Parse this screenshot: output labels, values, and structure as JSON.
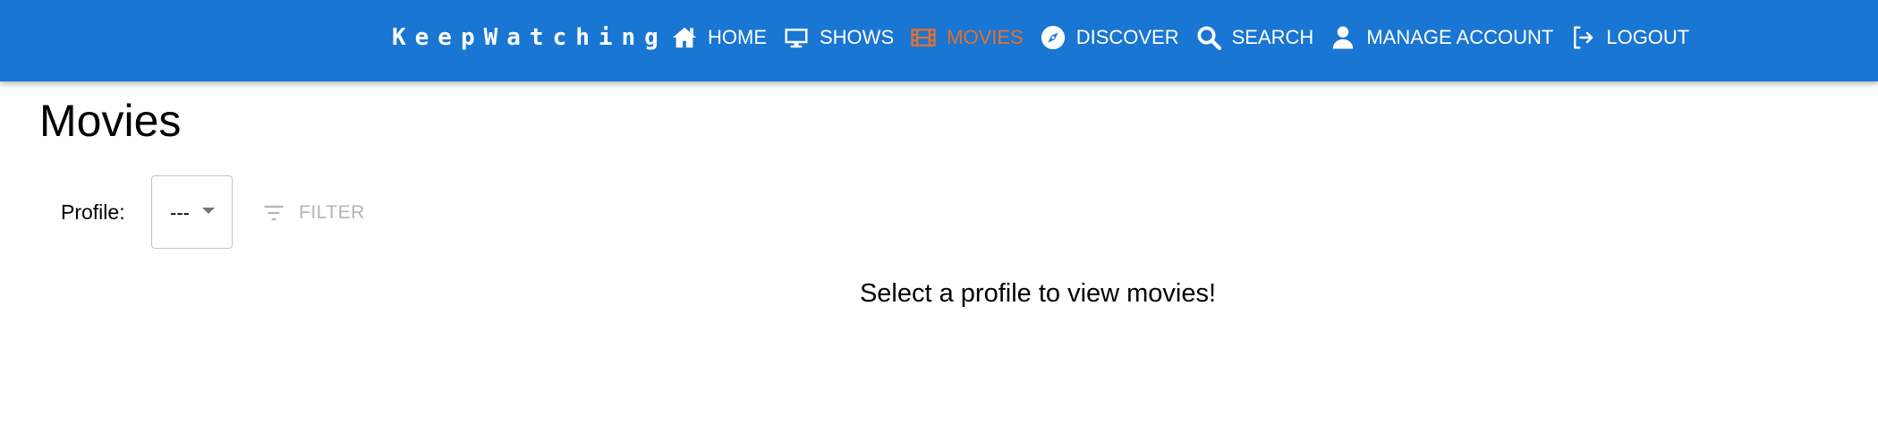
{
  "header": {
    "brand": "KeepWatching",
    "nav": [
      {
        "label": "HOME",
        "icon": "home-icon"
      },
      {
        "label": "SHOWS",
        "icon": "tv-icon"
      },
      {
        "label": "MOVIES",
        "icon": "film-icon",
        "active": true
      },
      {
        "label": "DISCOVER",
        "icon": "compass-icon"
      },
      {
        "label": "SEARCH",
        "icon": "search-icon"
      },
      {
        "label": "MANAGE ACCOUNT",
        "icon": "user-icon"
      },
      {
        "label": "LOGOUT",
        "icon": "logout-icon"
      }
    ]
  },
  "main": {
    "title": "Movies",
    "profile_label": "Profile:",
    "profile_value": "---",
    "filter_label": "FILTER",
    "empty_message": "Select a profile to view movies!"
  },
  "colors": {
    "appbar": "#1976d2",
    "active_nav": "#e8702a",
    "disabled_text": "#b4b4b4"
  }
}
